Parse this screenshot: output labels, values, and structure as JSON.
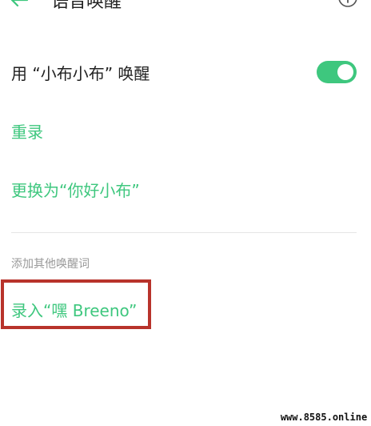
{
  "header": {
    "title": "语音唤醒",
    "back_icon": "arrow-left-icon",
    "info_icon": "info-circle-icon"
  },
  "wake_toggle": {
    "label": "用 “小布小布” 唤醒",
    "enabled": true,
    "color": "#3ec77e"
  },
  "actions": {
    "rerecord": "重录",
    "change_to": "更换为“你好小布”"
  },
  "other_wake_words": {
    "section_label": "添加其他唤醒词",
    "record_breeno": "录入“嘿 Breeno”"
  },
  "highlight_color": "#b8332b",
  "watermark": "www.8585.online"
}
